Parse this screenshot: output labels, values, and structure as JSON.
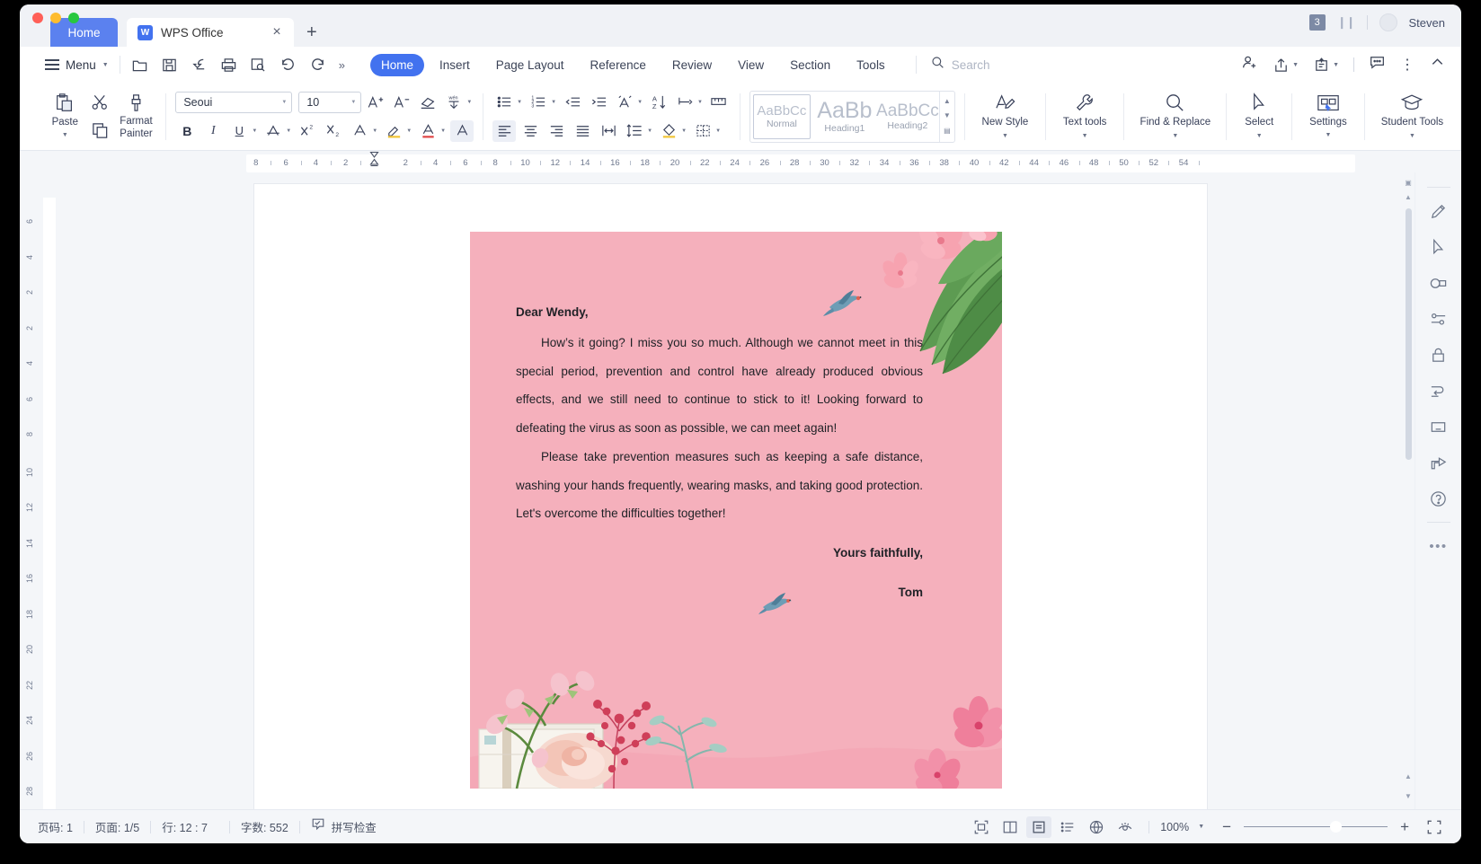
{
  "window": {
    "traffic_lights": [
      "close",
      "minimize",
      "maximize"
    ]
  },
  "tabbar": {
    "home_tab": "Home",
    "doc_tab": "WPS Office",
    "doc_icon": "wps-writer-icon",
    "close_icon": "close-icon",
    "new_tab_icon": "plus-icon",
    "count_badge": "3",
    "user_name": "Steven"
  },
  "menubar": {
    "menu_label": "Menu",
    "quick_access": [
      "open-icon",
      "save-icon",
      "save-as-icon",
      "print-icon",
      "print-preview-icon",
      "undo-icon",
      "redo-icon",
      "more-icon"
    ],
    "tabs": [
      {
        "label": "Home",
        "active": true
      },
      {
        "label": "Insert",
        "active": false
      },
      {
        "label": "Page Layout",
        "active": false
      },
      {
        "label": "Reference",
        "active": false
      },
      {
        "label": "Review",
        "active": false
      },
      {
        "label": "View",
        "active": false
      },
      {
        "label": "Section",
        "active": false
      },
      {
        "label": "Tools",
        "active": false
      }
    ],
    "search": {
      "placeholder": "Search",
      "value": "",
      "icon": "search-icon"
    },
    "right_icons": [
      "add-collaborator-icon",
      "share-icon",
      "export-pdf-icon",
      "comment-icon",
      "more-options-icon",
      "collapse-ribbon-icon"
    ]
  },
  "ribbon": {
    "paste": {
      "label": "Paste",
      "icon": "paste-icon"
    },
    "cut": {
      "label": "Cut",
      "icon": "scissors-icon"
    },
    "copy": {
      "label": "Copy",
      "icon": "copy-icon"
    },
    "format_painter": {
      "label": "Farmat Painter",
      "line1": "Farmat",
      "line2": "Painter",
      "icon": "format-painter-icon"
    },
    "font_name": {
      "value": "Seoui",
      "icon": "chevron-down-icon"
    },
    "font_size": {
      "value": "10",
      "icon": "chevron-down-icon"
    },
    "grow_font": "increase-font-size-icon",
    "shrink_font": "decrease-font-size-icon",
    "clear_format": "clear-formatting-icon",
    "phonetic": "phonetic-guide-icon",
    "bold": "bold-icon",
    "italic": "italic-icon",
    "underline": "underline-icon",
    "strikethrough": "strikethrough-icon",
    "superscript": "superscript-icon",
    "subscript": "subscript-icon",
    "text_effects": "text-effects-icon",
    "highlight": "highlight-color-icon",
    "font_color": "font-color-icon",
    "char_shading": "character-shading-icon",
    "bullets": "bullet-list-icon",
    "numbering": "numbered-list-icon",
    "decrease_indent": "decrease-indent-icon",
    "increase_indent": "increase-indent-icon",
    "smart_layout": "smart-typesetting-icon",
    "sort": "sort-icon",
    "show_marks": "show-paragraph-marks-icon",
    "ruler_tool": "ruler-icon",
    "align_left": "align-left-icon",
    "align_center": "align-center-icon",
    "align_right": "align-right-icon",
    "align_justify": "align-justify-icon",
    "distribute": "distribute-text-icon",
    "line_spacing": "line-spacing-icon",
    "shading": "paragraph-shading-icon",
    "borders": "borders-icon",
    "styles": [
      {
        "preview": "AaBbCc",
        "name": "Normal",
        "selected": true,
        "size": "15px"
      },
      {
        "preview": "AaBb",
        "name": "Heading1",
        "selected": false,
        "size": "25px"
      },
      {
        "preview": "AaBbCc",
        "name": "Heading2",
        "selected": false,
        "size": "19px"
      }
    ],
    "gallery_scroll": [
      "▲",
      "▼",
      "▤"
    ],
    "new_style": {
      "label": "New Style",
      "icon": "new-style-icon"
    },
    "text_tools": {
      "label": "Text tools",
      "icon": "wrench-icon"
    },
    "find_replace": {
      "label": "Find & Replace",
      "icon": "search-icon"
    },
    "select": {
      "label": "Select",
      "icon": "cursor-arrow-icon"
    },
    "settings": {
      "label": "Settings",
      "icon": "settings-screen-icon"
    },
    "student_tools": {
      "label": "Student Tools",
      "icon": "graduation-cap-icon"
    }
  },
  "ruler": {
    "h_ticks": [
      "8",
      "6",
      "4",
      "2",
      "2",
      "4",
      "6",
      "8",
      "10",
      "12",
      "14",
      "16",
      "18",
      "20",
      "22",
      "24",
      "26",
      "28",
      "30",
      "32",
      "34",
      "36",
      "38",
      "40",
      "42",
      "44",
      "46",
      "48",
      "50",
      "52",
      "54"
    ],
    "v_ticks": [
      "6",
      "4",
      "2",
      "2",
      "4",
      "6",
      "8",
      "10",
      "12",
      "14",
      "16",
      "18",
      "20",
      "22",
      "24",
      "26",
      "28"
    ]
  },
  "document": {
    "salutation": "Dear Wendy,",
    "paragraph1": "How’s it going? I miss you so much. Although we cannot meet in this special period, prevention and control have already produced obvious effects, and we still need to continue to stick to it! Looking forward to defeating the virus as soon as possible, we can meet again!",
    "paragraph2": "Please take prevention measures such as keeping a safe distance, washing your hands frequently, wearing masks, and taking good protection. Let's overcome the difficulties together!",
    "closing": "Yours faithfully,",
    "signature": "Tom",
    "background_color": "#f5b0bc",
    "decorations": [
      "tropical-leaves-flowers",
      "flying-bird-top",
      "flying-bird-bottom",
      "floral-bouquet-bottom"
    ]
  },
  "rightbar": {
    "icons": [
      "pen-tool-icon",
      "cursor-select-icon",
      "shapes-icon",
      "adjust-settings-icon",
      "lock-icon",
      "text-wrap-icon",
      "text-box-icon",
      "share-export-icon",
      "help-icon"
    ],
    "more_icon": "more-horizontal-icon"
  },
  "statusbar": {
    "page_number": "页码: 1",
    "page_count": "页面: 1/5",
    "line_col": "行: 12 : 7",
    "word_count": "字数: 552",
    "spell_check": "拼写检查",
    "spell_icon": "spellcheck-icon",
    "view_buttons": [
      {
        "icon": "full-screen-view-icon",
        "active": false
      },
      {
        "icon": "two-page-view-icon",
        "active": false
      },
      {
        "icon": "print-layout-view-icon",
        "active": true
      },
      {
        "icon": "outline-view-icon",
        "active": false
      },
      {
        "icon": "web-layout-view-icon",
        "active": false
      },
      {
        "icon": "reading-view-icon",
        "active": false
      }
    ],
    "zoom_level": "100%",
    "zoom_caret": "chevron-down-icon",
    "zoom_out": "−",
    "zoom_in": "+",
    "fit_screen": "fit-to-screen-icon"
  },
  "colors": {
    "accent": "#4272ef",
    "home_tab": "#5b81ef",
    "letter_bg": "#f5b0bc",
    "chrome": "#f4f6f9"
  }
}
